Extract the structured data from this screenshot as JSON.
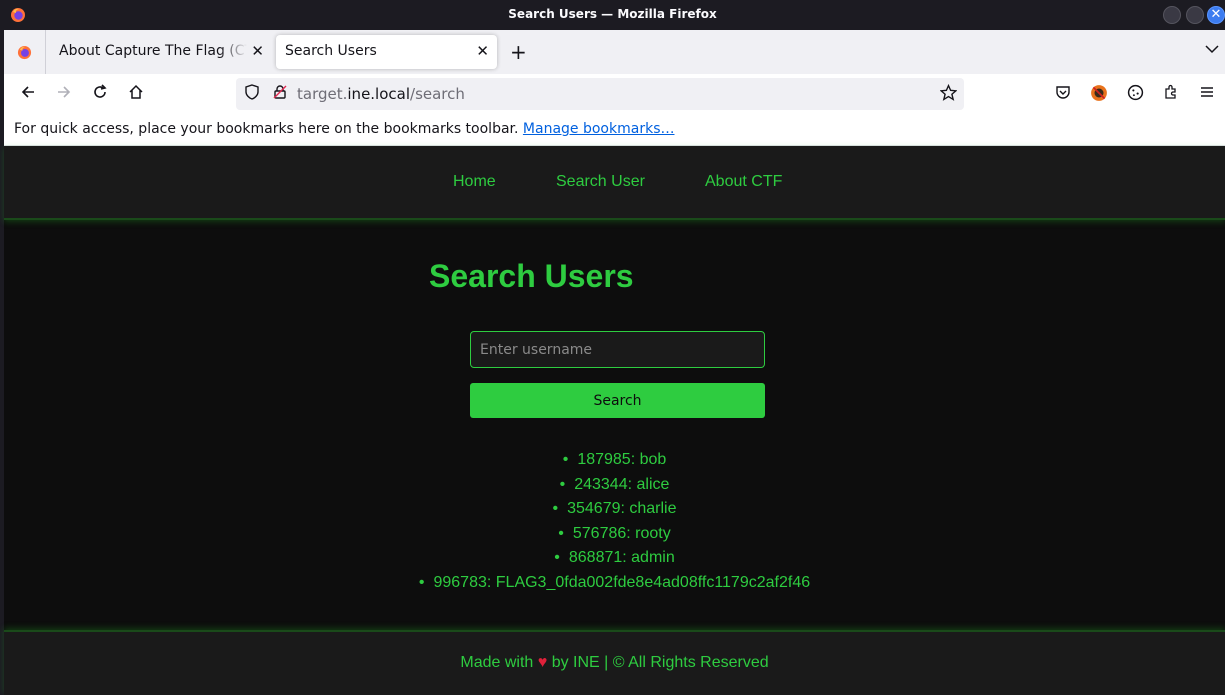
{
  "window": {
    "title": "Search Users — Mozilla Firefox"
  },
  "tabs": [
    {
      "label": "About Capture The Flag (CTF)",
      "active": false
    },
    {
      "label": "Search Users",
      "active": true
    }
  ],
  "navbar": {
    "url_scheme_part": "target.",
    "url_host": "ine.local",
    "url_path": "/search"
  },
  "bookmarks_bar": {
    "message": "For quick access, place your bookmarks here on the bookmarks toolbar.",
    "link": "Manage bookmarks…"
  },
  "site": {
    "nav": [
      "Home",
      "Search User",
      "About CTF"
    ],
    "heading": "Search Users",
    "search": {
      "placeholder": "Enter username",
      "value": "",
      "button": "Search"
    },
    "results": [
      "187985: bob",
      "243344: alice",
      "354679: charlie",
      "576786: rooty",
      "868871: admin",
      "996783: FLAG3_0fda002fde8e4ad08ffc1179c2af2f46"
    ],
    "footer": {
      "before": "Made with",
      "heart": "♥",
      "after": "by INE | © All Rights Reserved"
    }
  },
  "colors": {
    "accent": "#2ecc40",
    "page_bg": "#0d0d0d",
    "header_bg": "#1a1a1a"
  }
}
